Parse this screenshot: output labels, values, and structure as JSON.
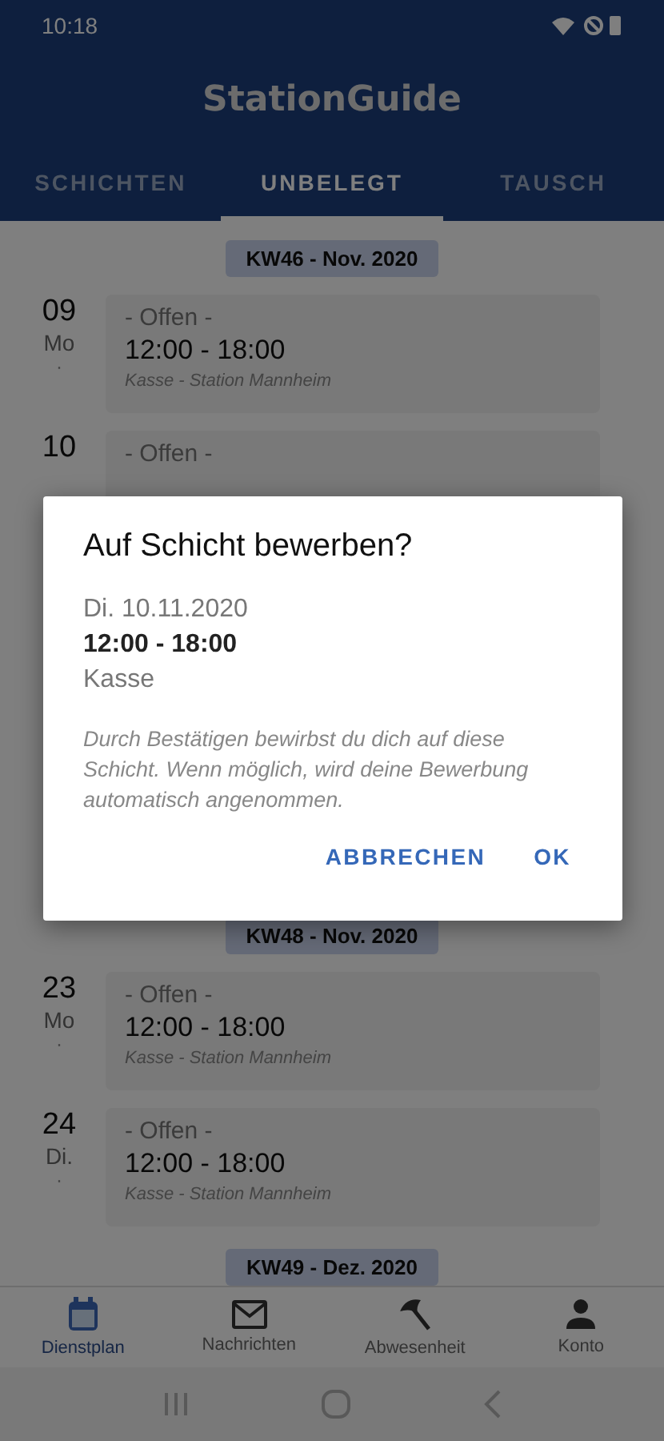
{
  "status_bar": {
    "time": "10:18"
  },
  "app_bar": {
    "title": "StationGuide"
  },
  "tabs": [
    {
      "label": "SCHICHTEN",
      "selected": false
    },
    {
      "label": "UNBELEGT",
      "selected": true
    },
    {
      "label": "TAUSCH",
      "selected": false
    }
  ],
  "weeks": [
    {
      "label": "KW46 - Nov. 2020",
      "days": [
        {
          "day": "09",
          "weekday": "Mo",
          "mark": "·",
          "status": "- Offen -",
          "time": "12:00 - 18:00",
          "location": "Kasse - Station Mannheim"
        },
        {
          "day": "10",
          "status": "- Offen -"
        }
      ]
    },
    {
      "label": "KW48 - Nov. 2020",
      "days": [
        {
          "day": "23",
          "weekday": "Mo",
          "mark": "·",
          "status": "- Offen -",
          "time": "12:00 - 18:00",
          "location": "Kasse - Station Mannheim"
        },
        {
          "day": "24",
          "weekday": "Di.",
          "mark": "·",
          "status": "- Offen -",
          "time": "12:00 - 18:00",
          "location": "Kasse - Station Mannheim"
        }
      ]
    },
    {
      "label": "KW49 - Dez. 2020"
    }
  ],
  "dialog": {
    "title": "Auf Schicht bewerben?",
    "date": "Di. 10.11.2020",
    "time": "12:00 - 18:00",
    "role": "Kasse",
    "note": "Durch Bestätigen bewirbst du dich auf diese Schicht. Wenn möglich, wird deine Bewerbung automatisch angenommen.",
    "buttons": [
      "ABBRECHEN",
      "OK"
    ]
  },
  "bottom_nav": [
    {
      "kind": "calendar",
      "label": "Dienstplan",
      "selected": true
    },
    {
      "kind": "mail",
      "label": "Nachrichten",
      "selected": false
    },
    {
      "kind": "umbrella",
      "label": "Abwesenheit",
      "selected": false
    },
    {
      "kind": "person",
      "label": "Konto",
      "selected": false
    }
  ]
}
